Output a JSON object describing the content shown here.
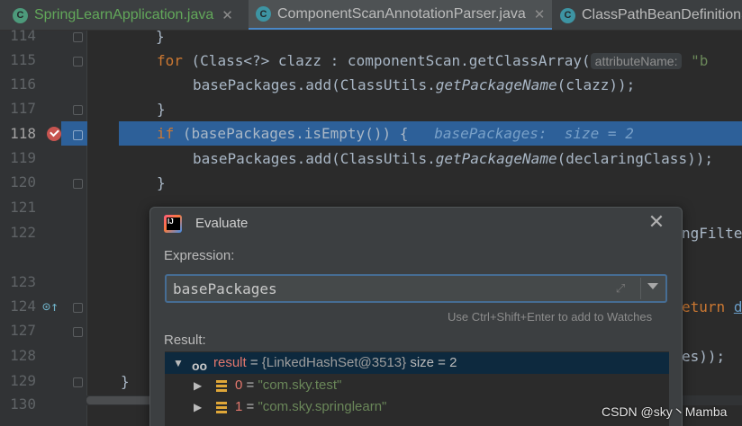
{
  "tabs": [
    {
      "label": "SpringLearnApplication.java",
      "icon": "app-class-icon",
      "active": false
    },
    {
      "label": "ComponentScanAnnotationParser.java",
      "icon": "class-icon",
      "active": true
    },
    {
      "label": "ClassPathBeanDefinitionS",
      "icon": "class-icon",
      "active": false
    }
  ],
  "gutter": {
    "lines": [
      "114",
      "115",
      "116",
      "117",
      "118",
      "119",
      "120",
      "121",
      "122",
      "123",
      "124",
      "127",
      "128",
      "129",
      "130"
    ],
    "current_line": "118"
  },
  "code": {
    "l114": "}",
    "l115_kw": "for",
    "l115_text": " (Class<?> clazz : componentScan.getClassArray(",
    "l115_hint": "attributeName:",
    "l115_tail": " \"b",
    "l116_a": "basePackages.add(ClassUtils.",
    "l116_m": "getPackageName",
    "l116_b": "(clazz));",
    "l117": "}",
    "l118_kw": "if",
    "l118_text": " (basePackages.isEmpty()) {",
    "l118_inline": "basePackages:  size = 2",
    "l119_a": "basePackages.add(ClassUtils.",
    "l119_m": "getPackageName",
    "l119_b": "(declaringClass));",
    "l120": "}",
    "l122_tail": "ngFilte",
    "l124_kw": "eturn",
    "l124_tail": "d",
    "l128_tail": "es));",
    "l129": "}"
  },
  "dialog": {
    "title": "Evaluate",
    "expression_label": "Expression:",
    "expression_value": "basePackages",
    "watch_hint": "Use Ctrl+Shift+Enter to add to Watches",
    "result_label": "Result:",
    "tree": {
      "root": {
        "name": "result",
        "eq": " = ",
        "obj": "{LinkedHashSet@3513}",
        "size": "size = 2"
      },
      "children": [
        {
          "index": "0",
          "eq": " = ",
          "value": "\"com.sky.test\""
        },
        {
          "index": "1",
          "eq": " = ",
          "value": "\"com.sky.springlearn\""
        }
      ]
    }
  },
  "watermark": "CSDN @sky丶Mamba",
  "colors": {
    "editor_bg": "#2b2b2b",
    "highlight": "#2d6099",
    "keyword": "#cc7832",
    "string": "#6a8759",
    "breakpoint": "#c75450"
  }
}
